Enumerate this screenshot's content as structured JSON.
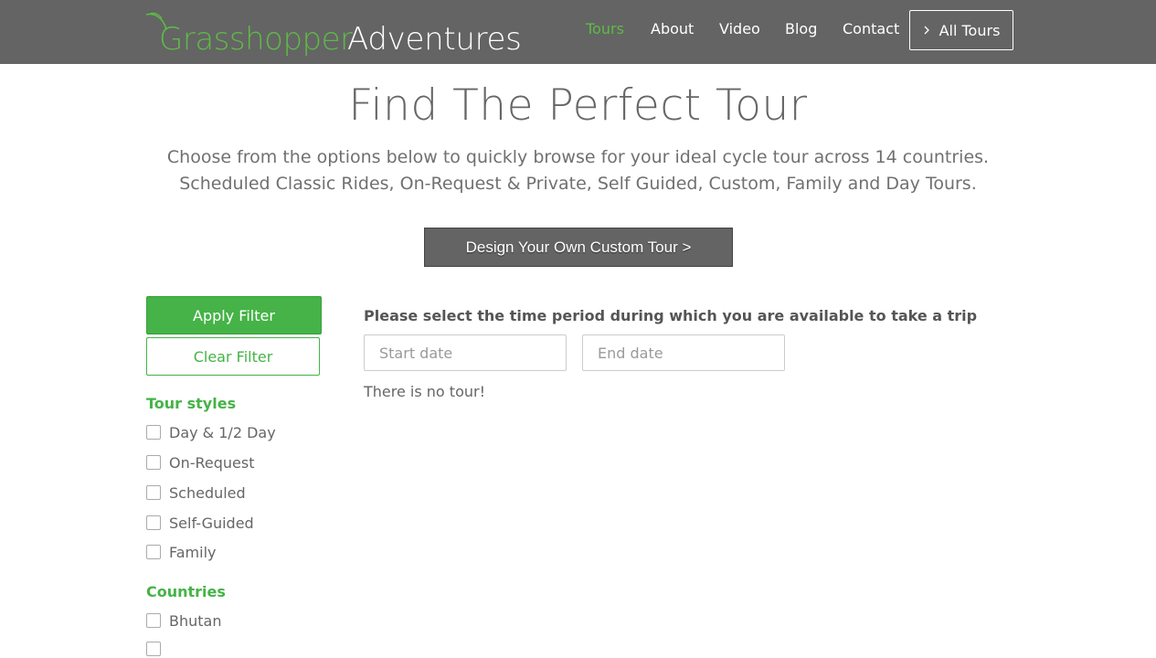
{
  "header": {
    "logo": {
      "part1": "Grasshopper",
      "part2": "Adventures"
    },
    "nav": [
      {
        "label": "Tours",
        "active": true
      },
      {
        "label": "About"
      },
      {
        "label": "Video"
      },
      {
        "label": "Blog"
      },
      {
        "label": "Contact"
      }
    ],
    "all_tours": {
      "label": "All Tours",
      "icon": "chevron-right-icon"
    }
  },
  "hero": {
    "title": "Find The Perfect Tour",
    "line1": "Choose from the options below to quickly browse for your ideal cycle tour across 14 countries.",
    "line2": "Scheduled Classic Rides, On-Request & Private, Self Guided, Custom, Family and Day Tours.",
    "custom_button": "Design Your Own Custom Tour >"
  },
  "filters": {
    "apply_label": "Apply Filter",
    "clear_label": "Clear Filter",
    "tour_styles_title": "Tour styles",
    "tour_styles": [
      {
        "label": "Day & 1/2 Day",
        "checked": false
      },
      {
        "label": "On-Request",
        "checked": false
      },
      {
        "label": "Scheduled",
        "checked": false
      },
      {
        "label": "Self-Guided",
        "checked": false
      },
      {
        "label": "Family",
        "checked": false
      }
    ],
    "countries_title": "Countries",
    "countries": [
      {
        "label": "Bhutan",
        "checked": false
      }
    ]
  },
  "results": {
    "period_label": "Please select the time period during which you are available to take a trip",
    "start_placeholder": "Start date",
    "end_placeholder": "End date",
    "empty_message": "There is no tour!"
  },
  "colors": {
    "brand_green": "#45b347",
    "header_gray": "#646464"
  }
}
